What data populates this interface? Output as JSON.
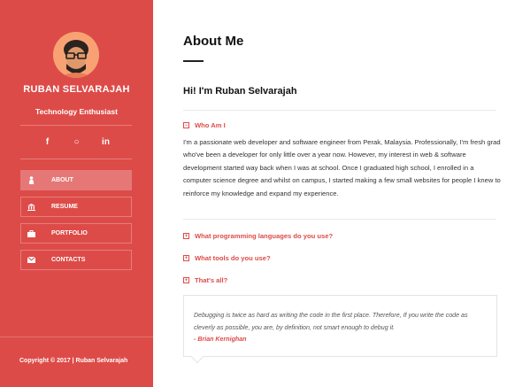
{
  "sidebar": {
    "name": "RUBAN SELVARAJAH",
    "tagline": "Technology Enthusiast",
    "social": [
      {
        "icon": "facebook-icon",
        "glyph": "f"
      },
      {
        "icon": "github-icon",
        "glyph": "○"
      },
      {
        "icon": "linkedin-icon",
        "glyph": "in"
      }
    ],
    "nav": [
      {
        "label": "ABOUT",
        "icon": "person-icon",
        "active": true
      },
      {
        "label": "RESUME",
        "icon": "bank-icon",
        "active": false
      },
      {
        "label": "PORTFOLIO",
        "icon": "briefcase-icon",
        "active": false
      },
      {
        "label": "CONTACTS",
        "icon": "envelope-icon",
        "active": false
      }
    ],
    "copyright": "Copyright © 2017 | Ruban Selvarajah"
  },
  "main": {
    "title": "About Me",
    "greeting": "Hi! I'm Ruban Selvarajah",
    "accordion": [
      {
        "question": "Who Am I",
        "expanded": true,
        "answer": "I'm a passionate web developer and software engineer from Perak, Malaysia. Professionally, I'm fresh grad who've been a developer for only little over a year now. However, my interest in web & software development started way back when I was at school. Once I graduated high school, I enrolled in a computer science degree and whilst on campus, I started making a few small websites for people I knew to reinforce my knowledge and expand my experience."
      },
      {
        "question": "What programming languages do you use?",
        "expanded": false
      },
      {
        "question": "What tools do you use?",
        "expanded": false
      },
      {
        "question": "That's all?",
        "expanded": false
      }
    ],
    "quote": {
      "text": "Debugging is twice as hard as writing the code in the first place. Therefore, If you write the code as cleverly as possible, you are, by definition, not smart enough to debug it.",
      "author": "- Brian Kernighan"
    }
  },
  "colors": {
    "accent": "#dd4b48",
    "sidebar_bg": "#dd4b48",
    "heading": "#111111",
    "body_text": "#333333"
  }
}
